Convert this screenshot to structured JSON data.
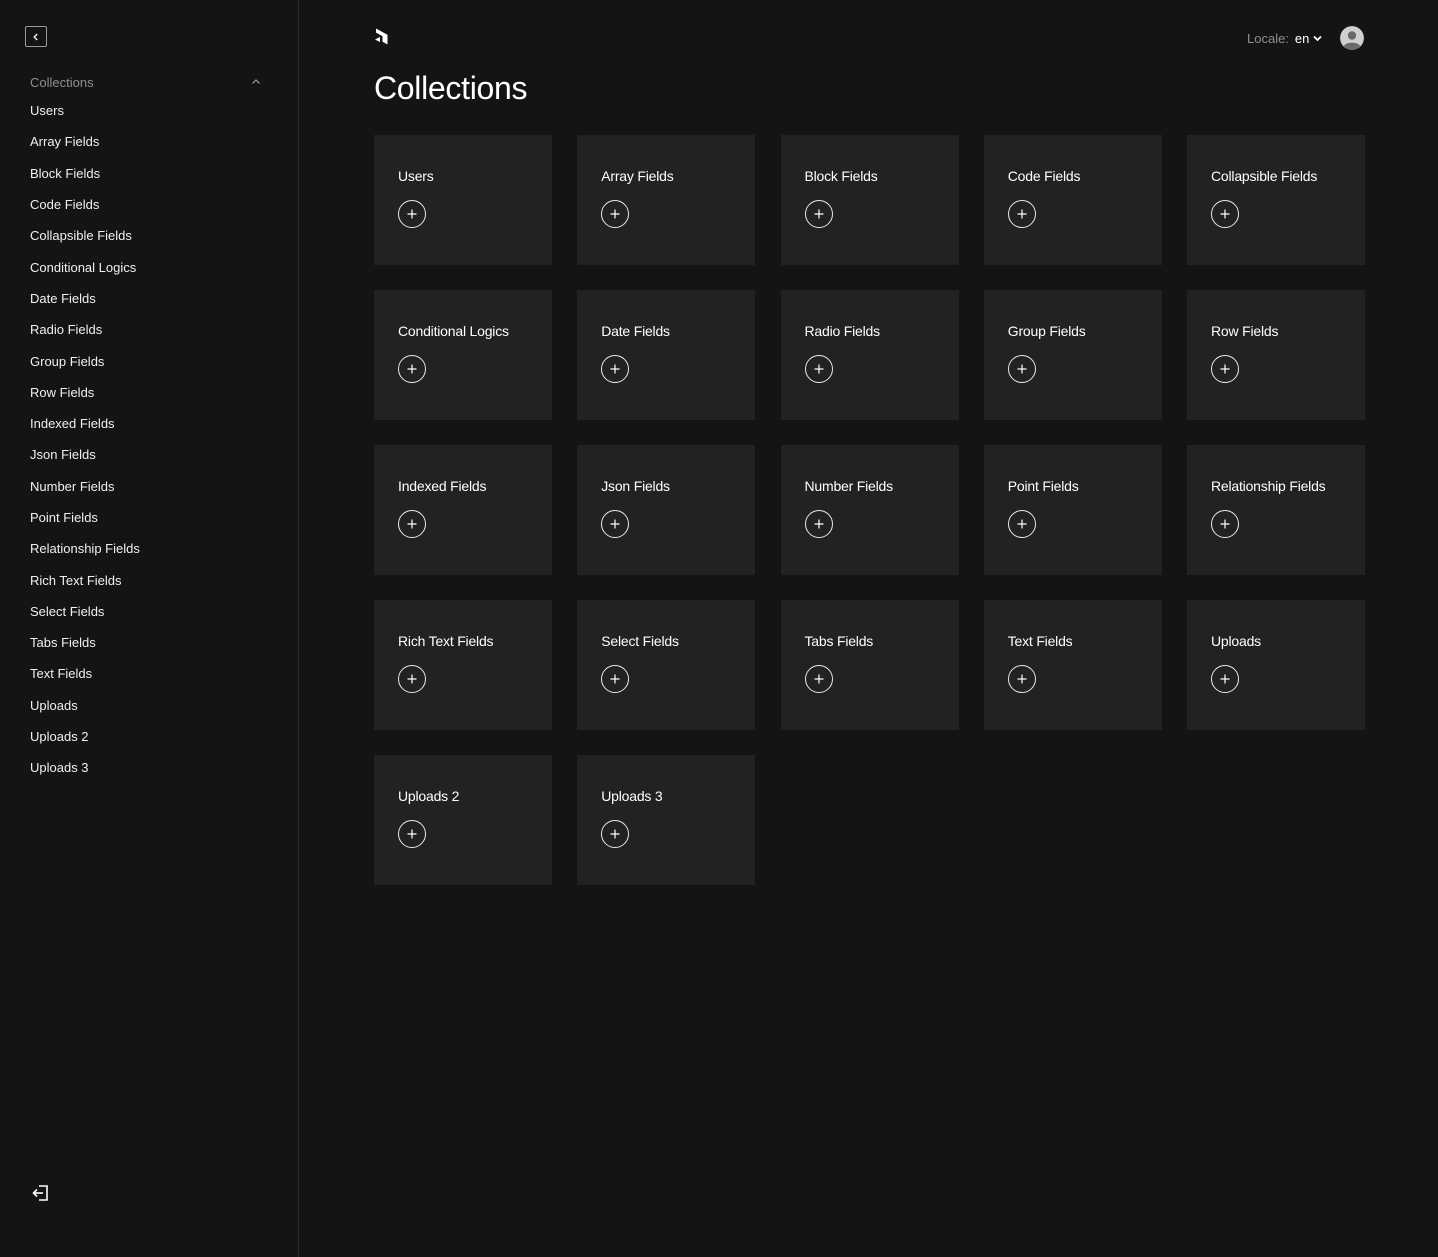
{
  "sidebar": {
    "collapse_icon": "chevron-left-icon",
    "group_title": "Collections",
    "group_toggle_icon": "chevron-up-icon",
    "items": [
      {
        "label": "Users"
      },
      {
        "label": "Array Fields"
      },
      {
        "label": "Block Fields"
      },
      {
        "label": "Code Fields"
      },
      {
        "label": "Collapsible Fields"
      },
      {
        "label": "Conditional Logics"
      },
      {
        "label": "Date Fields"
      },
      {
        "label": "Radio Fields"
      },
      {
        "label": "Group Fields"
      },
      {
        "label": "Row Fields"
      },
      {
        "label": "Indexed Fields"
      },
      {
        "label": "Json Fields"
      },
      {
        "label": "Number Fields"
      },
      {
        "label": "Point Fields"
      },
      {
        "label": "Relationship Fields"
      },
      {
        "label": "Rich Text Fields"
      },
      {
        "label": "Select Fields"
      },
      {
        "label": "Tabs Fields"
      },
      {
        "label": "Text Fields"
      },
      {
        "label": "Uploads"
      },
      {
        "label": "Uploads 2"
      },
      {
        "label": "Uploads 3"
      }
    ],
    "logout_icon": "logout-icon"
  },
  "header": {
    "logo_icon": "payload-logo-icon",
    "locale_label": "Locale:",
    "locale_value": "en",
    "locale_icon": "chevron-down-icon",
    "avatar_icon": "user-avatar-icon"
  },
  "main": {
    "title": "Collections",
    "cards": [
      {
        "title": "Users"
      },
      {
        "title": "Array Fields"
      },
      {
        "title": "Block Fields"
      },
      {
        "title": "Code Fields"
      },
      {
        "title": "Collapsible Fields"
      },
      {
        "title": "Conditional Logics"
      },
      {
        "title": "Date Fields"
      },
      {
        "title": "Radio Fields"
      },
      {
        "title": "Group Fields"
      },
      {
        "title": "Row Fields"
      },
      {
        "title": "Indexed Fields"
      },
      {
        "title": "Json Fields"
      },
      {
        "title": "Number Fields"
      },
      {
        "title": "Point Fields"
      },
      {
        "title": "Relationship Fields"
      },
      {
        "title": "Rich Text Fields"
      },
      {
        "title": "Select Fields"
      },
      {
        "title": "Tabs Fields"
      },
      {
        "title": "Text Fields"
      },
      {
        "title": "Uploads"
      },
      {
        "title": "Uploads 2"
      },
      {
        "title": "Uploads 3"
      }
    ],
    "card_add_icon": "plus-circle-icon"
  },
  "colors": {
    "background": "#141414",
    "card_background": "#222222",
    "muted_text": "#8f8f8f",
    "text": "#ffffff"
  }
}
